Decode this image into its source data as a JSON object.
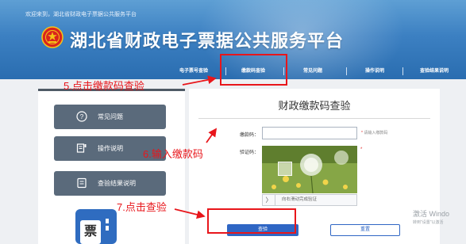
{
  "header": {
    "welcome": "欢迎来到，湖北省财政电子票据公共服务平台",
    "site_title": "湖北省财政电子票据公共服务平台"
  },
  "nav": {
    "items": [
      "电子票号查验",
      "缴款码查验",
      "常见问题",
      "操作说明",
      "查验结果说明"
    ],
    "active_index": 1
  },
  "sidebar": {
    "items": [
      {
        "label": "常见问题",
        "icon": "help-circle-icon"
      },
      {
        "label": "操作说明",
        "icon": "manual-icon"
      },
      {
        "label": "查验结果说明",
        "icon": "document-icon"
      }
    ],
    "ticket_icon_char": "票"
  },
  "panel": {
    "title": "财政缴款码查验",
    "code_label": "缴款码：",
    "code_value": "",
    "code_hint_required": "*",
    "code_hint": "请输入缴款码",
    "captcha_label": "验证码：",
    "captcha_required": "*",
    "slider_text": "向右滑动完成验证",
    "slider_handle": "〉",
    "query_button": "查验",
    "reset_button": "重置"
  },
  "annotations": {
    "step5": "5.点击缴款码查验",
    "step6": "6.输入缴款码",
    "step7": "7.点击查验"
  },
  "watermark": {
    "line1": "激活 Windo",
    "line2": "转到\"设置\"以激活"
  },
  "colors": {
    "header_blue": "#3c80c2",
    "annotation_red": "#e8161b",
    "button_blue": "#2f66c4",
    "sidebar_button": "#5a6a7b"
  }
}
